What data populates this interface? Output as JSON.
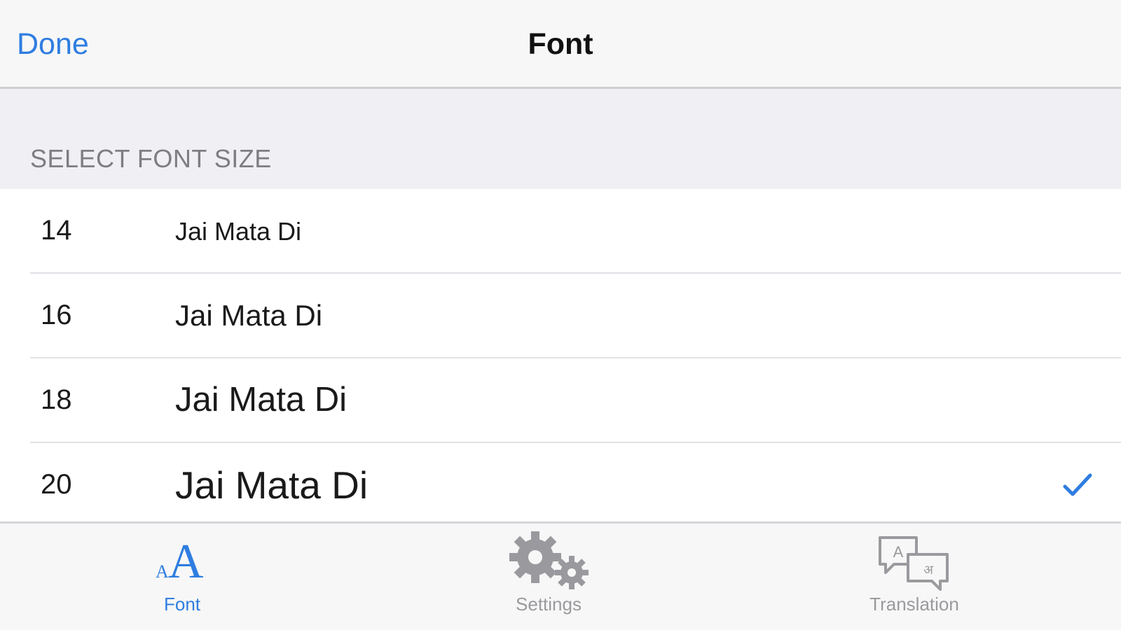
{
  "navbar": {
    "done_label": "Done",
    "title": "Font"
  },
  "section": {
    "header": "SELECT FONT SIZE"
  },
  "rows": [
    {
      "size": "14",
      "sample": "Jai Mata Di",
      "selected": false
    },
    {
      "size": "16",
      "sample": "Jai Mata Di",
      "selected": false
    },
    {
      "size": "18",
      "sample": "Jai Mata Di",
      "selected": false
    },
    {
      "size": "20",
      "sample": "Jai Mata Di",
      "selected": true
    }
  ],
  "tabbar": {
    "tabs": [
      {
        "label": "Font",
        "icon": "font-size-icon",
        "active": true
      },
      {
        "label": "Settings",
        "icon": "gears-icon",
        "active": false
      },
      {
        "label": "Translation",
        "icon": "translation-bubbles-icon",
        "active": false
      }
    ]
  },
  "colors": {
    "accent": "#2f7de1",
    "inactive": "#9a9a9e",
    "section_background": "#efeff4",
    "bar_background": "#f7f7f7"
  }
}
